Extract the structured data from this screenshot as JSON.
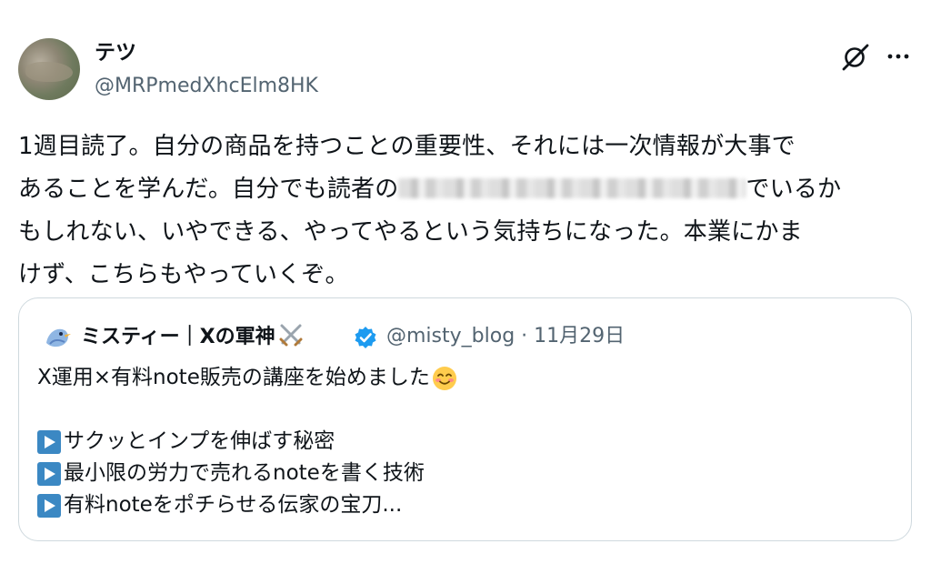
{
  "author": {
    "display_name": "テツ",
    "handle": "@MRPmedXhcElm8HK",
    "avatar_icon": "landscape-photo-avatar"
  },
  "actions": {
    "grok_icon": "grok-icon",
    "more_icon": "more-dots-icon"
  },
  "tweet": {
    "line1": "1週目読了。自分の商品を持つことの重要性、それには一次情報が大事で",
    "line2_start": "あることを学んだ。自分でも読者の",
    "line2_end": "でいるか",
    "line3": "もしれない、いやできる、やってやるという気持ちになった。本業にかま",
    "line4": "けず、こちらもやっていくぞ。"
  },
  "quote": {
    "display_name": "ミスティー｜Xの軍神",
    "name_emoji": "crossed-swords-icon",
    "verified_icon": "verified-badge-icon",
    "handle": "@misty_blog",
    "separator": "·",
    "date": "11月29日",
    "text_line1": "X運用×有料note販売の講座を始めました",
    "bullets": [
      "サクッとインプを伸ばす秘密",
      "最小限の労力で売れるnoteを書く技術",
      "有料noteをポチらせる伝家の宝刀..."
    ],
    "colors": {
      "verified": "#1d9bf0",
      "bullet": "#3b88c3",
      "border": "#cfd9de",
      "secondary": "#536471"
    }
  }
}
